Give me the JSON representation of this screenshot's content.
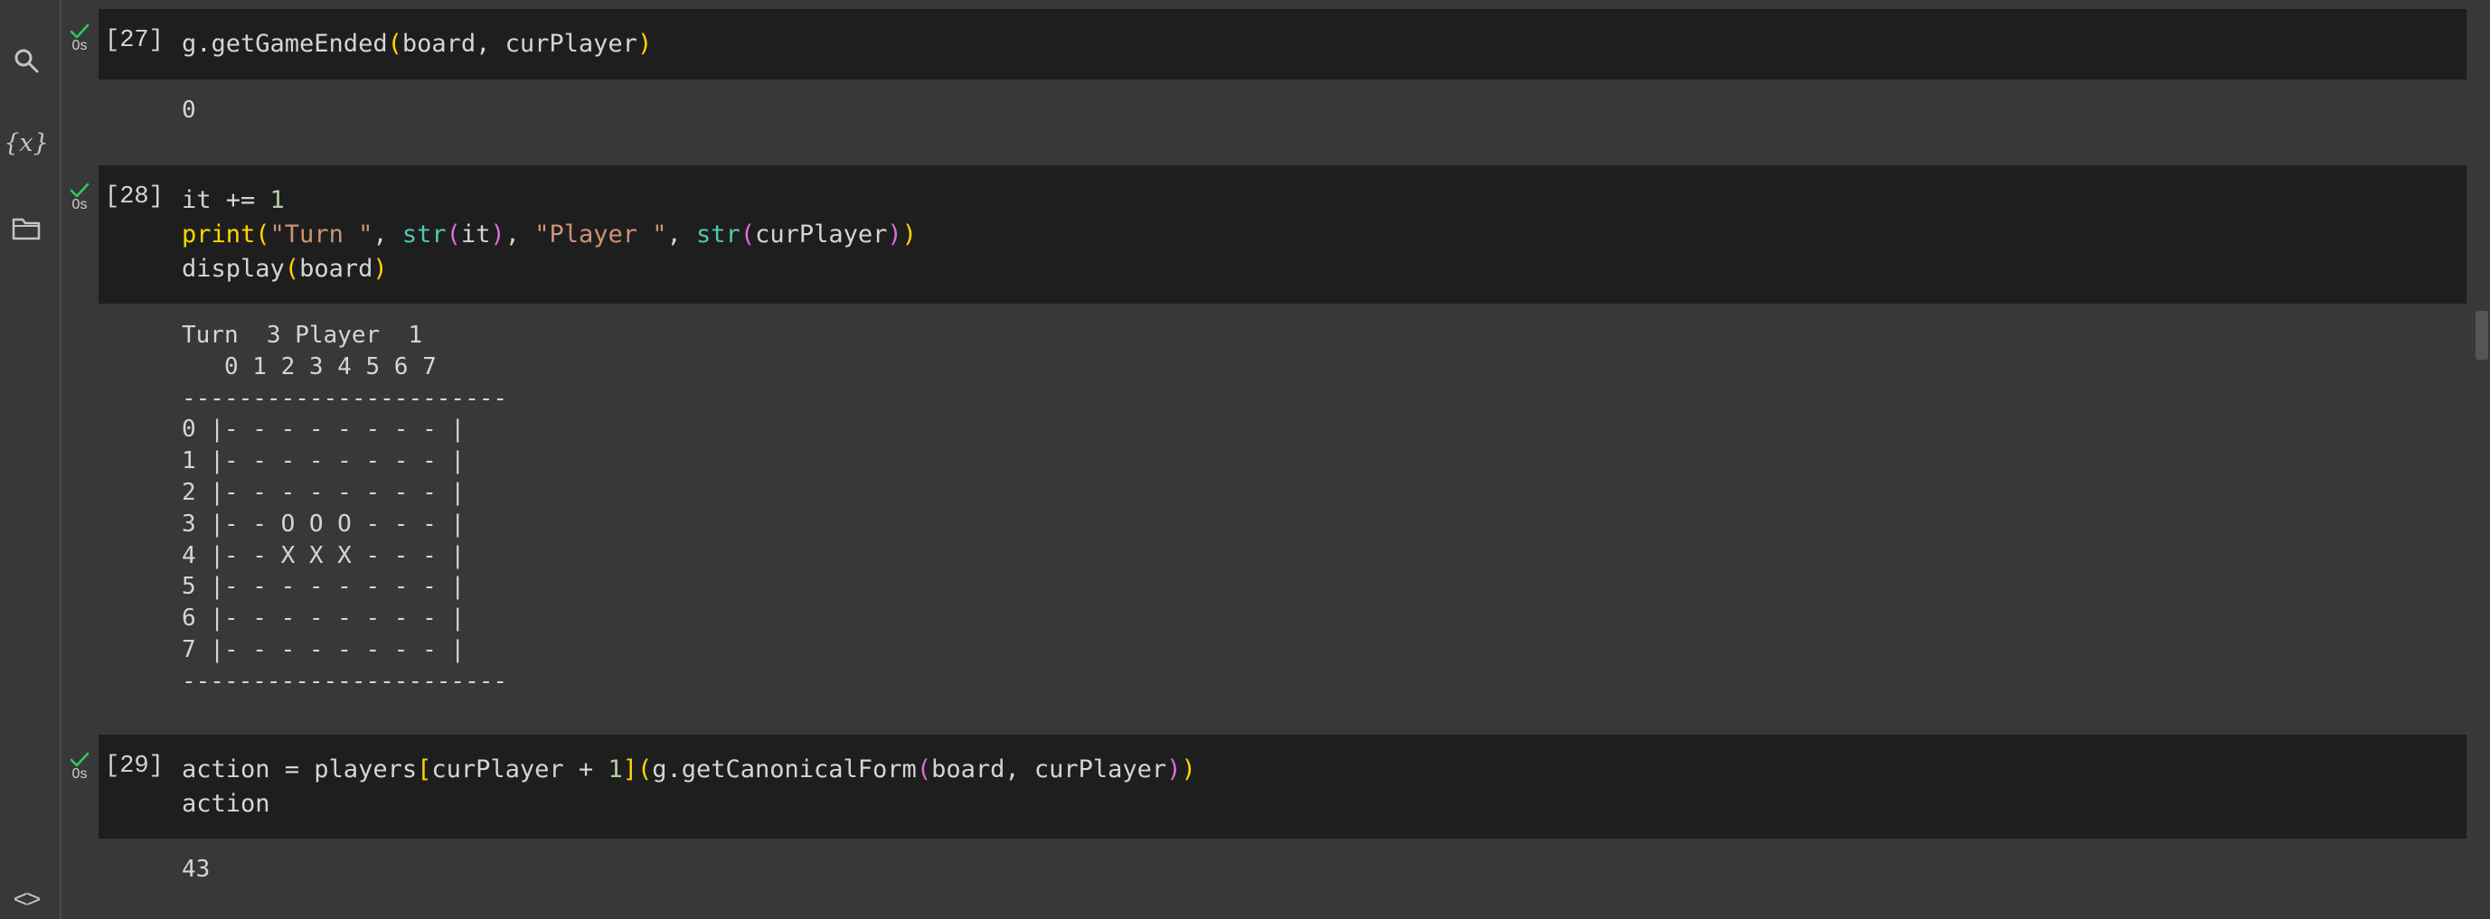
{
  "sidebar": {
    "search_icon": "search-icon",
    "variables_glyph": "{x}",
    "files_icon": "folder-icon",
    "code_glyph": "<>"
  },
  "cells": [
    {
      "exec_count": "[27]",
      "duration": "0s",
      "code_lines": [
        "g.getGameEnded(board, curPlayer)"
      ],
      "output": [
        "0"
      ]
    },
    {
      "exec_count": "[28]",
      "duration": "0s",
      "code_lines": [
        "it += 1",
        "print(\"Turn \", str(it), \"Player \", str(curPlayer))",
        "display(board)"
      ],
      "output": [
        "Turn  3 Player  1",
        "   0 1 2 3 4 5 6 7",
        "-----------------------",
        "0 |- - - - - - - - |",
        "1 |- - - - - - - - |",
        "2 |- - - - - - - - |",
        "3 |- - O O O - - - |",
        "4 |- - X X X - - - |",
        "5 |- - - - - - - - |",
        "6 |- - - - - - - - |",
        "7 |- - - - - - - - |",
        "-----------------------"
      ]
    },
    {
      "exec_count": "[29]",
      "duration": "0s",
      "code_lines": [
        "action = players[curPlayer + 1](g.getCanonicalForm(board, curPlayer))",
        "action"
      ],
      "output": [
        "43"
      ]
    }
  ],
  "colors": {
    "background": "#383838",
    "cell_background": "#1e1e1e",
    "success_check": "#34c759",
    "bracket_level1": "#ffd700",
    "bracket_level2": "#da70d6",
    "string": "#ce9178",
    "builtin": "#4ec9b0",
    "number": "#b5cea8"
  }
}
